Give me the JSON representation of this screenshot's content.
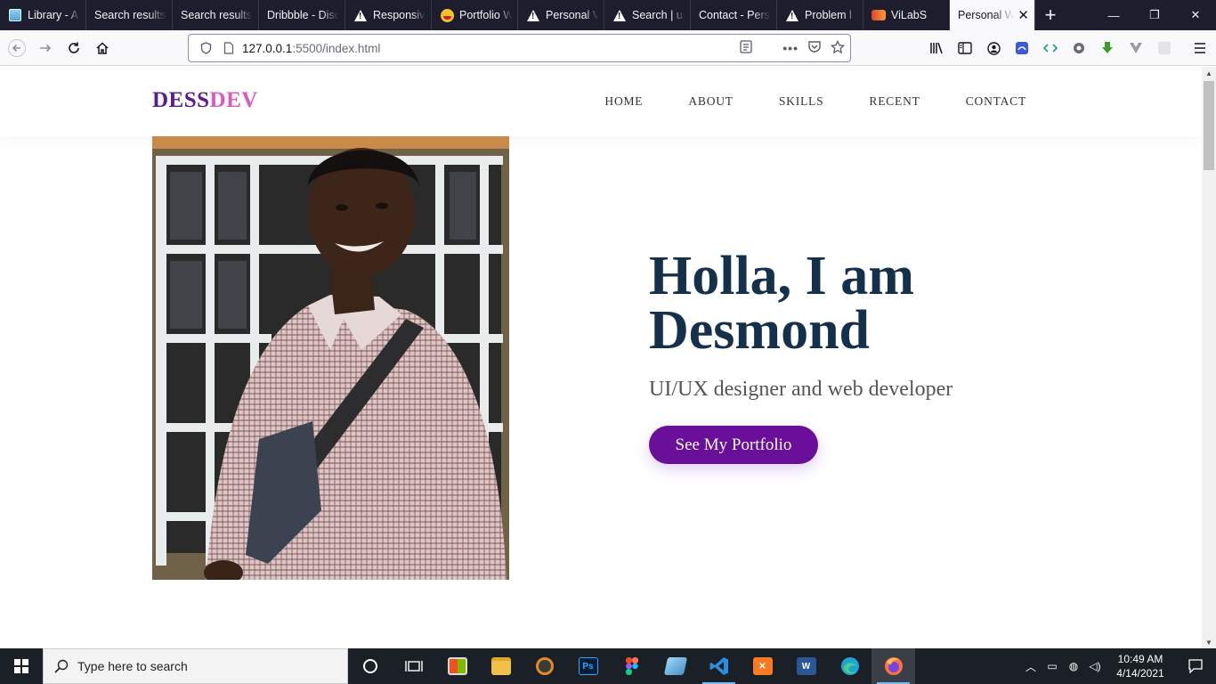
{
  "browser": {
    "tabs": [
      {
        "label": "Library - A",
        "icon": "library-icon"
      },
      {
        "label": "Search results",
        "icon": "none"
      },
      {
        "label": "Search results",
        "icon": "none"
      },
      {
        "label": "Dribbble - Disc",
        "icon": "none"
      },
      {
        "label": "Responsiv",
        "icon": "warning-icon"
      },
      {
        "label": "Portfolio W",
        "icon": "emoji-icon"
      },
      {
        "label": "Personal V",
        "icon": "warning-icon"
      },
      {
        "label": "Search | ur",
        "icon": "warning-icon"
      },
      {
        "label": "Contact - Pers",
        "icon": "none"
      },
      {
        "label": "Problem l",
        "icon": "warning-icon"
      },
      {
        "label": "ViLabS",
        "icon": "vilabs-icon"
      }
    ],
    "active_tab": {
      "label": "Personal W",
      "close": "✕"
    },
    "new_tab": "+",
    "window_controls": {
      "minimize": "—",
      "restore": "❐",
      "close": "✕"
    },
    "url_host": "127.0.0.1",
    "url_rest": ":5500/index.html"
  },
  "site": {
    "logo_part1": "DESS",
    "logo_part2": "DEV",
    "nav": {
      "home": "HOME",
      "about": "ABOUT",
      "skills": "SKILLS",
      "recent": "RECENT",
      "contact": "CONTACT"
    },
    "hero_title": "Holla, I am Desmond",
    "hero_subtitle": "UI/UX designer and web developer",
    "cta_label": "See My Portfolio",
    "colors": {
      "logo_dark": "#5b1a8e",
      "logo_light": "#d95bbd",
      "heading": "#14304a",
      "button": "#6a0f9a"
    }
  },
  "taskbar": {
    "search_placeholder": "Type here to search",
    "time": "10:49 AM",
    "date": "4/14/2021"
  }
}
